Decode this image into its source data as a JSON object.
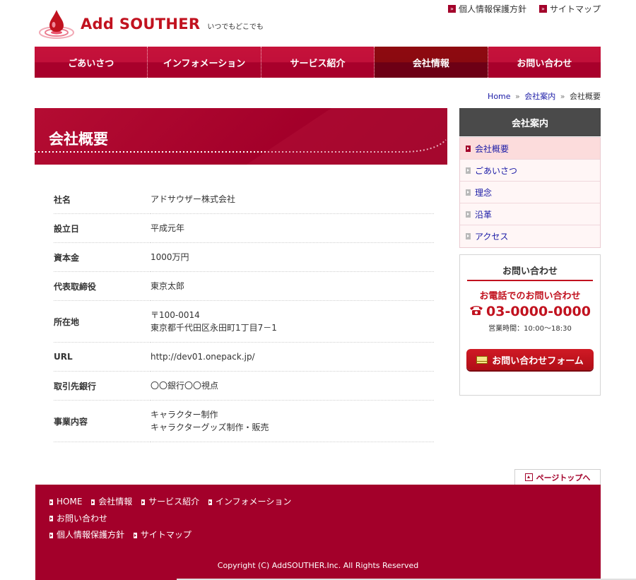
{
  "header": {
    "logo_title": "Add SOUTHER",
    "logo_subtitle": "いつでもどこでも",
    "util_links": [
      {
        "label": "個人情報保護方針",
        "icon": "arrow-square-icon"
      },
      {
        "label": "サイトマップ",
        "icon": "arrow-square-icon"
      }
    ]
  },
  "nav": {
    "items": [
      {
        "label": "ごあいさつ"
      },
      {
        "label": "インフォメーション"
      },
      {
        "label": "サービス紹介"
      },
      {
        "label": "会社情報",
        "active": true
      },
      {
        "label": "お問い合わせ"
      }
    ]
  },
  "breadcrumb": {
    "home": "Home",
    "sep": "»",
    "parent": "会社案内",
    "current": "会社概要"
  },
  "main": {
    "title": "会社概要",
    "rows": [
      {
        "key": "社名",
        "value": [
          "アドサウザー株式会社"
        ]
      },
      {
        "key": "設立日",
        "value": [
          "平成元年"
        ]
      },
      {
        "key": "資本金",
        "value": [
          "1000万円"
        ]
      },
      {
        "key": "代表取締役",
        "value": [
          "東京太郎"
        ]
      },
      {
        "key": "所在地",
        "value": [
          "〒100-0014",
          "東京都千代田区永田町1丁目7－1"
        ]
      },
      {
        "key": "URL",
        "value": [
          "http://dev01.onepack.jp/"
        ]
      },
      {
        "key": "取引先銀行",
        "value": [
          "〇〇銀行〇〇視点"
        ]
      },
      {
        "key": "事業内容",
        "value": [
          "キャラクター制作",
          "キャラクターグッズ制作・販売"
        ]
      }
    ]
  },
  "sidebar": {
    "heading": "会社案内",
    "items": [
      {
        "label": "会社概要",
        "active": true
      },
      {
        "label": "ごあいさつ"
      },
      {
        "label": "理念"
      },
      {
        "label": "沿革"
      },
      {
        "label": "アクセス"
      }
    ],
    "contact": {
      "title": "お問い合わせ",
      "lead": "お電話でのお問い合わせ",
      "phone": "03-0000-0000",
      "hours": "営業時間：10:00〜18:30",
      "button": "お問い合わせフォーム"
    }
  },
  "page_top": "ページトップへ",
  "footer": {
    "links": [
      "HOME",
      "会社情報",
      "サービス紹介",
      "インフォメーション",
      "お問い合わせ",
      "個人情報保護方針",
      "サイトマップ"
    ],
    "copyright": "Copyright (C) AddSOUTHER.Inc. All Rights Reserved"
  },
  "colors": {
    "brand": "#a3002a",
    "accent": "#c1121f",
    "nav_active": "#7a0a12",
    "sidebar_head": "#4a4a4a"
  }
}
